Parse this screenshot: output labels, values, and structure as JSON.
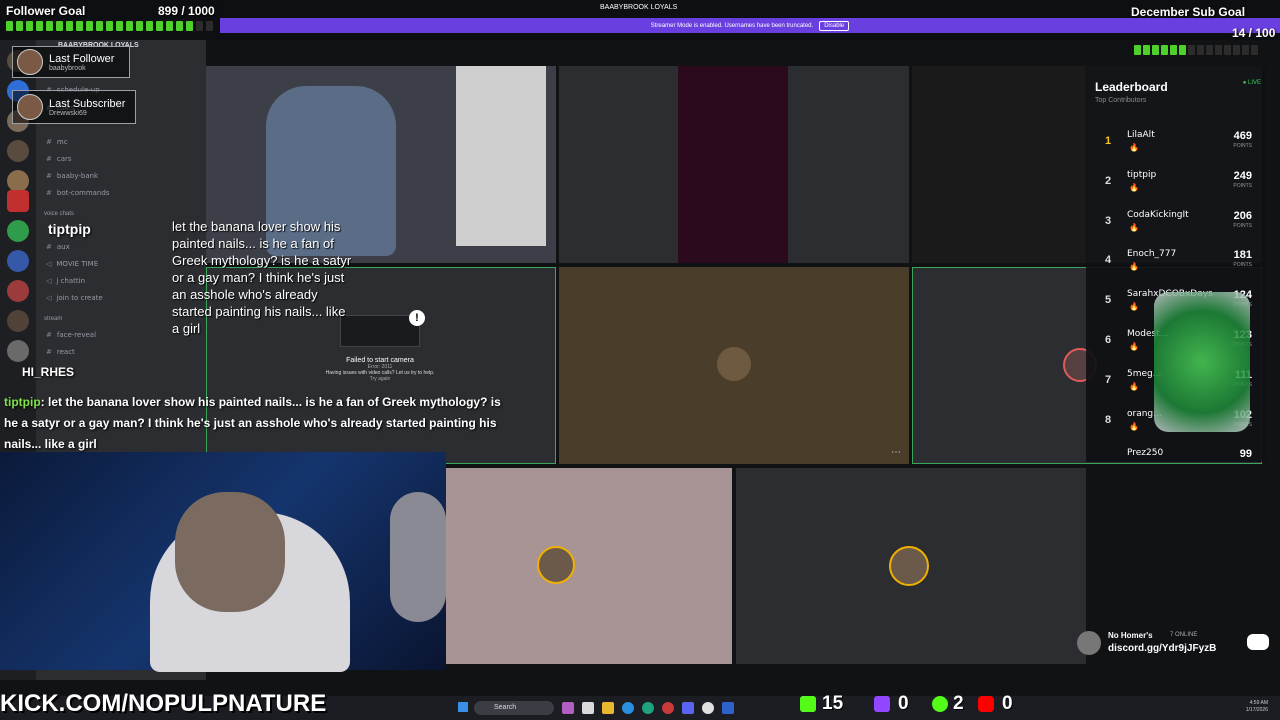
{
  "top": {
    "channel_name": "BAABYBROOK LOYALS",
    "banner_text": "Streamer Mode is enabled. Usernames have been truncated.",
    "banner_button": "Disable"
  },
  "follower_goal": {
    "title": "Follower Goal",
    "count": "899 / 1000",
    "progress": 0.899
  },
  "sub_goal": {
    "title": "December Sub Goal",
    "count": "14 / 100",
    "progress": 0.14
  },
  "last_follower": {
    "label": "Last Follower",
    "name": "baabybrook"
  },
  "last_subscriber": {
    "label": "Last Subscriber",
    "name": "Drewwski69"
  },
  "sidebar": {
    "server": "BAABYBROOK LOYALS",
    "channels": [
      "schedule-up",
      "rules",
      "mc",
      "cars",
      "baaby-bank",
      "bot-commands"
    ],
    "voice_category": "voice chats",
    "voice_channels": [
      "aux",
      "MOVIE TIME",
      "j chattin",
      "join to create"
    ],
    "stream_category": "stream",
    "stream_channels": [
      "face-reveal",
      "react"
    ]
  },
  "overlay_names": {
    "speaker": "tiptpip",
    "other": "HI_RHES"
  },
  "caption": "let the banana lover show his painted nails... is he a fan of Greek mythology? is he a satyr or a gay man? I think he's just an asshole who's already started painting his nails... like a girl",
  "chat": {
    "user": "tiptpip",
    "message": "let the banana lover show his painted nails... is he a fan of Greek mythology? is he a satyr or a gay man? I think he's just an asshole who's already started painting his nails... like a girl"
  },
  "failed_camera": {
    "title": "Failed to start camera",
    "error": "Error: 2011",
    "help": "Having issues with video calls? Let us try to help.",
    "retry": "Try again"
  },
  "leaderboard": {
    "title": "Leaderboard",
    "subtitle": "Top Contributors",
    "live": "● LIVE",
    "points_label": "POINTS",
    "rows": [
      {
        "rank": "1",
        "name": "LilaAlt",
        "points": "469"
      },
      {
        "rank": "2",
        "name": "tiptpip",
        "points": "249"
      },
      {
        "rank": "3",
        "name": "CodaKickingIt",
        "points": "206"
      },
      {
        "rank": "4",
        "name": "Enoch_777",
        "points": "181"
      },
      {
        "rank": "5",
        "name": "SarahxDCOBxDays",
        "points": "124"
      },
      {
        "rank": "6",
        "name": "Modest...",
        "points": "123"
      },
      {
        "rank": "7",
        "name": "5meg...",
        "points": "111"
      },
      {
        "rank": "8",
        "name": "orang...",
        "points": "102"
      },
      {
        "rank": "",
        "name": "Prez250",
        "points": "99"
      }
    ]
  },
  "discord_widget": {
    "name": "No Homer's",
    "online": "7 ONLINE",
    "link": "discord.gg/Ydr9jJFyzB"
  },
  "bottom": {
    "brand": "KICK.COM/NOPULPNATURE",
    "search": "Search",
    "stats": [
      "15",
      "0",
      "2",
      "0"
    ],
    "time": "4:59 AM",
    "date": "1/17/2026"
  },
  "colors": {
    "kick_green": "#53fc18",
    "twitch_purple": "#9146ff",
    "youtube_red": "#ff0000",
    "banner_purple": "#6a3fe0",
    "speaking_green": "#3ba55d"
  }
}
